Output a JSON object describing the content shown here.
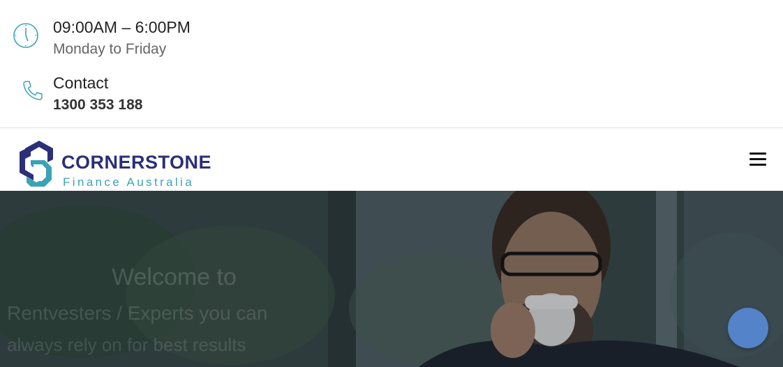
{
  "header_info": {
    "hours": {
      "time": "09:00AM – 6:00PM",
      "days": "Monday to Friday",
      "icon": "clock-icon"
    },
    "contact": {
      "label": "Contact",
      "phone": "1300 353 188",
      "icon": "phone-icon"
    },
    "icon_color": "#3aa3b5"
  },
  "brand": {
    "name": "CORNERSTONE",
    "tagline": "Finance Australia",
    "name_color": "#2a2f78",
    "tagline_color": "#3aa3b5"
  },
  "nav": {
    "menu_icon": "hamburger-menu-icon"
  },
  "hero": {
    "heading": "Welcome to",
    "line1": "Rentvesters / Experts you can",
    "line2": "always rely on for best results"
  },
  "chat": {
    "icon": "chat-bubble-icon",
    "color": "#5483c9"
  }
}
